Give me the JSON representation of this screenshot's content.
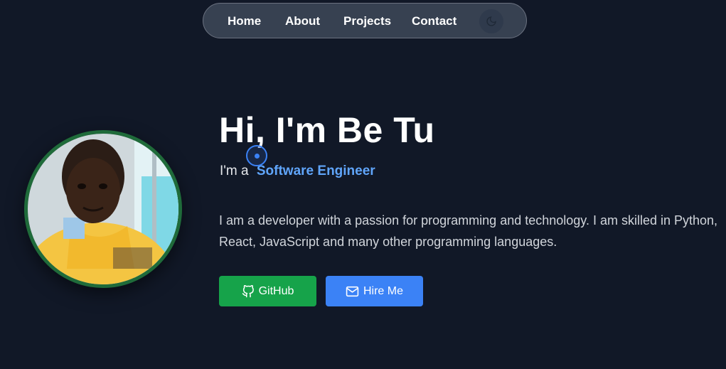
{
  "nav": {
    "items": [
      "Home",
      "About",
      "Projects",
      "Contact"
    ],
    "theme_toggle_icon": "moon-icon"
  },
  "hero": {
    "title": "Hi, I'm Be Tu",
    "subtitle_prefix": "I'm a",
    "role": "Software Engineer",
    "bio": "I am a developer with a passion for programming and technology. I am skilled in Python, React, JavaScript and many other programming languages.",
    "avatar_icon": "profile-photo"
  },
  "buttons": {
    "github_label": "GitHub",
    "github_icon": "github-icon",
    "hire_label": "Hire Me",
    "hire_icon": "mail-icon"
  },
  "colors": {
    "background": "#111827",
    "accent": "#60a5fa",
    "github_button": "#16a34a",
    "hire_button": "#3b82f6",
    "avatar_border": "#1f6b3a"
  }
}
